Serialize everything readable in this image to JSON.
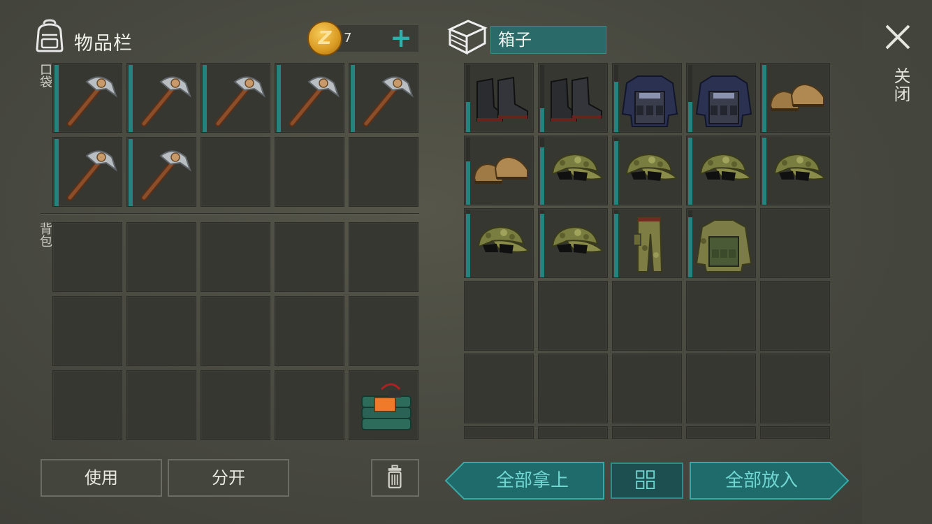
{
  "inventory": {
    "title": "物品栏",
    "pocket_label": "口袋",
    "backpack_label": "背包"
  },
  "currency": {
    "count": "7",
    "coin_symbol": "Z",
    "add_symbol": "+"
  },
  "chest": {
    "name": "箱子"
  },
  "close": {
    "label": "关闭"
  },
  "pocket_slots": [
    {
      "item": "pickaxe",
      "durability": 1.0
    },
    {
      "item": "pickaxe",
      "durability": 1.0
    },
    {
      "item": "pickaxe",
      "durability": 1.0
    },
    {
      "item": "pickaxe",
      "durability": 1.0
    },
    {
      "item": "pickaxe",
      "durability": 1.0
    },
    {
      "item": "pickaxe",
      "durability": 1.0
    },
    {
      "item": "pickaxe",
      "durability": 1.0
    },
    {
      "item": null
    },
    {
      "item": null
    },
    {
      "item": null
    }
  ],
  "backpack_slots": [
    {
      "item": null
    },
    {
      "item": null
    },
    {
      "item": null
    },
    {
      "item": null
    },
    {
      "item": null
    },
    {
      "item": null
    },
    {
      "item": null
    },
    {
      "item": null
    },
    {
      "item": null
    },
    {
      "item": null
    },
    {
      "item": null
    },
    {
      "item": null
    },
    {
      "item": null
    },
    {
      "item": null
    },
    {
      "item": "c4-explosive",
      "durability": null
    }
  ],
  "chest_slots": [
    {
      "item": "black-boots",
      "durability": 0.45
    },
    {
      "item": "black-boots",
      "durability": 0.35
    },
    {
      "item": "police-vest",
      "durability": 0.75
    },
    {
      "item": "police-vest",
      "durability": 0.45
    },
    {
      "item": "leather-shoes",
      "durability": 1.0
    },
    {
      "item": "leather-shoes",
      "durability": 0.65
    },
    {
      "item": "camo-cap",
      "durability": 0.85
    },
    {
      "item": "camo-cap",
      "durability": 0.95
    },
    {
      "item": "camo-cap",
      "durability": 1.0
    },
    {
      "item": "camo-cap",
      "durability": 1.0
    },
    {
      "item": "camo-cap",
      "durability": 0.95
    },
    {
      "item": "camo-cap",
      "durability": 0.95
    },
    {
      "item": "camo-pants",
      "durability": 0.95
    },
    {
      "item": "camo-jacket",
      "durability": 0.9
    },
    {
      "item": null
    },
    {
      "item": null
    },
    {
      "item": null
    },
    {
      "item": null
    },
    {
      "item": null
    },
    {
      "item": null
    },
    {
      "item": null
    },
    {
      "item": null
    },
    {
      "item": null
    },
    {
      "item": null
    },
    {
      "item": null
    }
  ],
  "buttons": {
    "use": "使用",
    "split": "分开",
    "trash": "trash-icon",
    "take_all": "全部拿上",
    "put_all": "全部放入",
    "sort": "sort-grid-icon"
  },
  "colors": {
    "teal": "#2fb0ac",
    "durability": "#25837f",
    "slot": "#363731"
  }
}
